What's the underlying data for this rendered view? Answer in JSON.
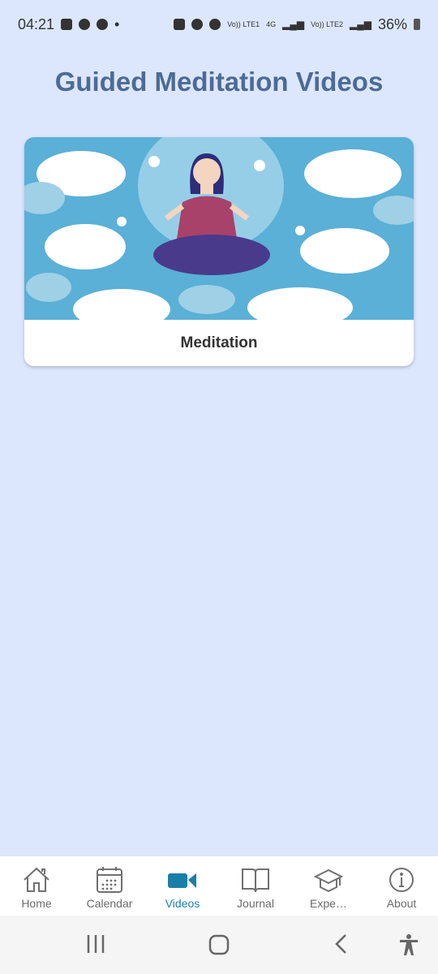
{
  "status_bar": {
    "time": "04:21",
    "battery": "36%",
    "net_labels": [
      "Vo)) LTE1",
      "4G",
      "Vo)) LTE2"
    ]
  },
  "page": {
    "title": "Guided Meditation Videos"
  },
  "videos": [
    {
      "title": "Meditation",
      "thumbnail": "woman-meditating-in-clouds"
    }
  ],
  "nav": {
    "active": "Videos",
    "accent": "#1a7fa8",
    "items": [
      {
        "label": "Home",
        "icon": "home-icon"
      },
      {
        "label": "Calendar",
        "icon": "calendar-icon"
      },
      {
        "label": "Videos",
        "icon": "video-icon"
      },
      {
        "label": "Journal",
        "icon": "book-icon"
      },
      {
        "label": "Expe…",
        "icon": "graduation-cap-icon"
      },
      {
        "label": "About",
        "icon": "info-icon"
      }
    ]
  }
}
